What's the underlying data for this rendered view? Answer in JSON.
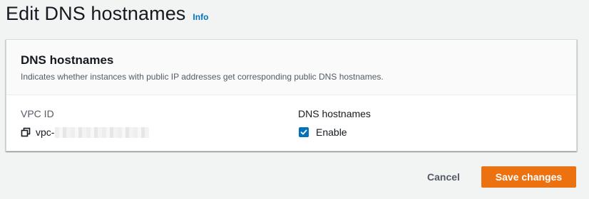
{
  "header": {
    "title": "Edit DNS hostnames",
    "info_label": "Info"
  },
  "card": {
    "title": "DNS hostnames",
    "description": "Indicates whether instances with public IP addresses get corresponding public DNS hostnames."
  },
  "vpc": {
    "label": "VPC ID",
    "value_prefix": "vpc-",
    "value_redacted": true,
    "copy_icon": "copy-icon"
  },
  "dns_hostnames": {
    "label": "DNS hostnames",
    "checkbox_label": "Enable",
    "checked": true
  },
  "actions": {
    "cancel_label": "Cancel",
    "save_label": "Save changes"
  },
  "colors": {
    "accent": "#0073bb",
    "primary_button": "#ec7211",
    "background": "#f2f3f3"
  }
}
